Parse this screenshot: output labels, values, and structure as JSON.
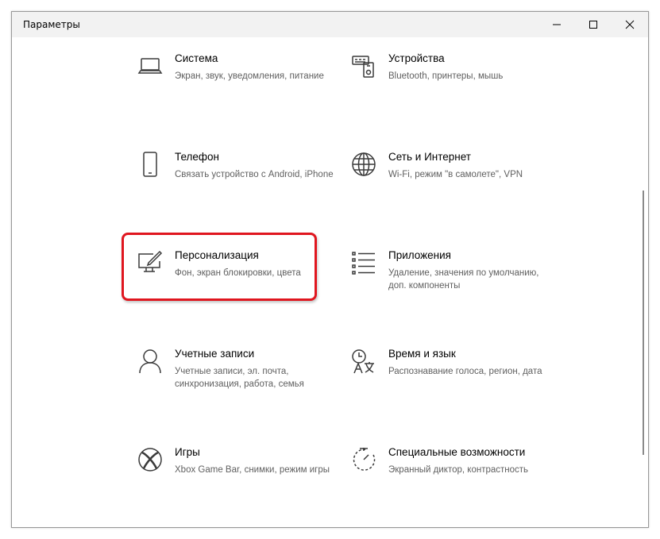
{
  "window": {
    "title": "Параметры",
    "minimize_label": "Свернуть",
    "maximize_label": "Развернуть",
    "close_label": "Закрыть"
  },
  "settings": [
    {
      "title": "Система",
      "description": "Экран, звук, уведомления, питание",
      "icon": "laptop-icon"
    },
    {
      "title": "Устройства",
      "description": "Bluetooth, принтеры, мышь",
      "icon": "devices-icon"
    },
    {
      "title": "Телефон",
      "description": "Связать устройство с Android, iPhone",
      "icon": "phone-icon"
    },
    {
      "title": "Сеть и Интернет",
      "description": "Wi-Fi, режим \"в самолете\", VPN",
      "icon": "globe-icon"
    },
    {
      "title": "Персонализация",
      "description": "Фон, экран блокировки, цвета",
      "icon": "personalization-icon"
    },
    {
      "title": "Приложения",
      "description": "Удаление, значения по умолчанию, доп. компоненты",
      "icon": "apps-list-icon"
    },
    {
      "title": "Учетные записи",
      "description": "Учетные записи, эл. почта, синхронизация, работа, семья",
      "icon": "person-icon"
    },
    {
      "title": "Время и язык",
      "description": "Распознавание голоса, регион, дата",
      "icon": "time-language-icon"
    },
    {
      "title": "Игры",
      "description": "Xbox Game Bar, снимки, режим игры",
      "icon": "xbox-icon"
    },
    {
      "title": "Специальные возможности",
      "description": "Экранный диктор, контрастность",
      "icon": "accessibility-timer-icon"
    }
  ],
  "highlighted_item": "Персонализация",
  "colors": {
    "highlight": "#e0161f",
    "title_bar": "#f2f2f2",
    "description": "#5f5f5f"
  }
}
